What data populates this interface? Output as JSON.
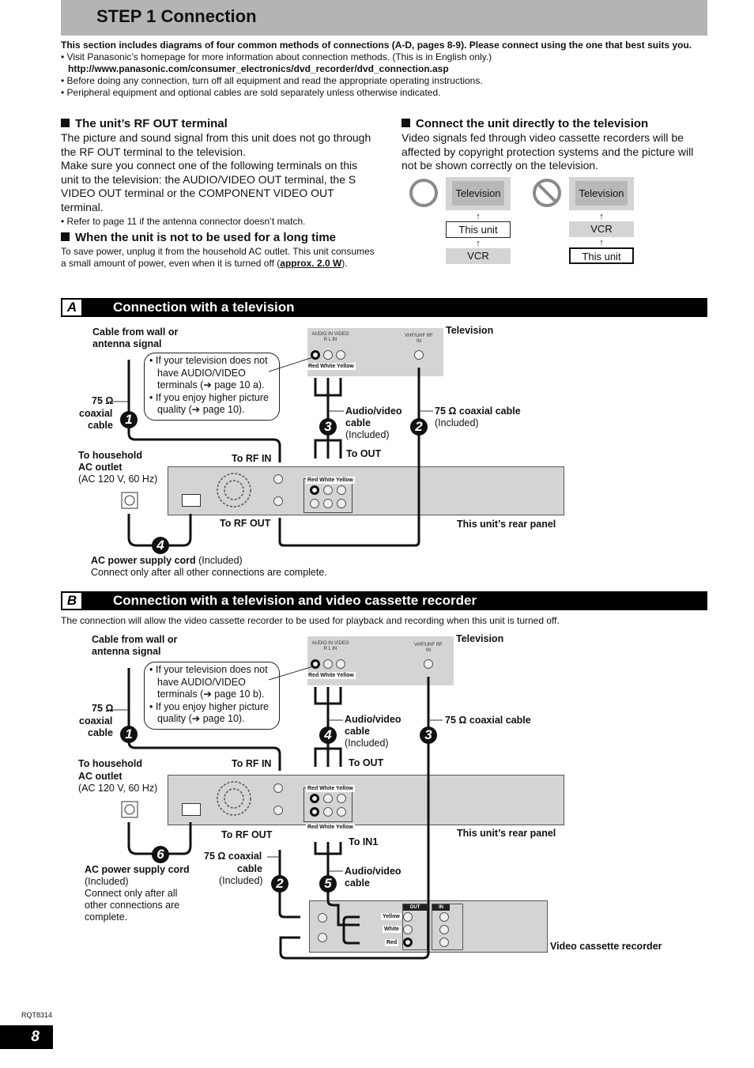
{
  "header": {
    "title": "STEP 1 Connection"
  },
  "intro": {
    "lead": "This section includes diagrams of four common methods of connections (A-D, pages 8-9). Please connect using the one that best suits you.",
    "bullets": [
      "• Visit Panasonic’s homepage for more information about connection methods. (This is in English only.)",
      "• Before doing any connection, turn off all equipment and read the appropriate operating instructions.",
      "• Peripheral equipment and optional cables are sold separately unless otherwise indicated."
    ],
    "url": "http://www.panasonic.com/consumer_electronics/dvd_recorder/dvd_connection.asp"
  },
  "rf_out": {
    "heading": "The unit’s RF OUT terminal",
    "para1": "The picture and sound signal from this unit does not go through the RF OUT terminal to the television.",
    "para2": "Make sure you connect one of the following terminals on this unit to the television: the AUDIO/VIDEO OUT terminal, the S VIDEO OUT terminal or the COMPONENT VIDEO OUT terminal.",
    "note": "• Refer to page 11 if the antenna connector doesn’t match."
  },
  "long_time": {
    "heading": "When the unit is not to be used for a long time",
    "text_before": "To save power, unplug it from the household AC outlet. This unit consumes a small amount of power, even when it is turned off (",
    "power": "approx. 2.0 W",
    "text_after": ")."
  },
  "direct": {
    "heading": "Connect the unit directly to the television",
    "para": "Video signals fed through video cassette recorders will be affected by copyright protection systems and the picture will not be shown correctly on the television.",
    "correct": {
      "icon": "ok-circle-icon",
      "chain": [
        "Television",
        "This unit",
        "VCR"
      ]
    },
    "wrong": {
      "icon": "prohibited-icon",
      "chain": [
        "Television",
        "VCR",
        "This unit"
      ]
    }
  },
  "section_a": {
    "letter": "A",
    "title": "Connection with a television",
    "labels": {
      "cable_from_wall": "Cable from wall or antenna signal",
      "television": "Television",
      "coax_left_1": "75 Ω",
      "coax_left_2": "coaxial",
      "coax_left_3": "cable",
      "note": [
        "If your television does not have AUDIO/VIDEO terminals (➔ page 10 a).",
        "If you enjoy higher picture quality (➔ page 10)."
      ],
      "av_cable": "Audio/video cable",
      "av_included": "(Included)",
      "coax_right": "75 Ω coaxial cable",
      "coax_right_included": "(Included)",
      "household_1": "To household",
      "household_2": "AC outlet",
      "household_3": "(AC 120 V, 60 Hz)",
      "to_rf_in": "To RF IN",
      "to_out": "To OUT",
      "to_rf_out": "To RF OUT",
      "rear_panel": "This unit’s rear panel",
      "ac_cord": "AC power supply cord",
      "ac_included": " (Included)",
      "ac_note": "Connect only after all other connections are complete.",
      "tv_audio_in": "AUDIO IN  VIDEO",
      "tv_rl": "R    L     IN",
      "tv_rf": "VHF/UHF RF IN",
      "rwy": "Red White Yellow"
    },
    "steps": [
      "1",
      "2",
      "3",
      "4"
    ]
  },
  "section_b": {
    "letter": "B",
    "title": "Connection with a television and video cassette recorder",
    "desc": "The connection will allow the video cassette recorder to be used for playback and recording when this unit is turned off.",
    "labels": {
      "cable_from_wall": "Cable from wall or antenna signal",
      "television": "Television",
      "coax_left_1": "75 Ω",
      "coax_left_2": "coaxial",
      "coax_left_3": "cable",
      "note": [
        "If your television does not have AUDIO/VIDEO terminals (➔ page 10 b).",
        "If you enjoy higher picture quality (➔ page 10)."
      ],
      "av_cable": "Audio/video cable",
      "av_included": "(Included)",
      "coax_right": "75 Ω coaxial cable",
      "household_1": "To household",
      "household_2": "AC outlet",
      "household_3": "(AC 120 V, 60 Hz)",
      "to_rf_in": "To RF IN",
      "to_out": "To OUT",
      "to_rf_out": "To RF OUT",
      "to_in1": "To IN1",
      "rear_panel": "This unit’s rear panel",
      "coax_mid_1": "75 Ω coaxial",
      "coax_mid_2": "cable",
      "coax_mid_3": "(Included)",
      "av_cable2_1": "Audio/video",
      "av_cable2_2": "cable",
      "ac_cord": "AC power supply cord",
      "ac_included": "(Included)",
      "ac_note": "Connect only after all other connections are complete.",
      "vcr": "Video cassette recorder",
      "vcr_out": "OUT",
      "vcr_in": "IN",
      "vcr_yellow": "Yellow",
      "vcr_white": "White",
      "vcr_red": "Red",
      "rwy": "Red White Yellow"
    },
    "steps": [
      "1",
      "2",
      "3",
      "4",
      "5",
      "6"
    ]
  },
  "footer": {
    "doc_code": "RQT8314",
    "page": "8"
  }
}
